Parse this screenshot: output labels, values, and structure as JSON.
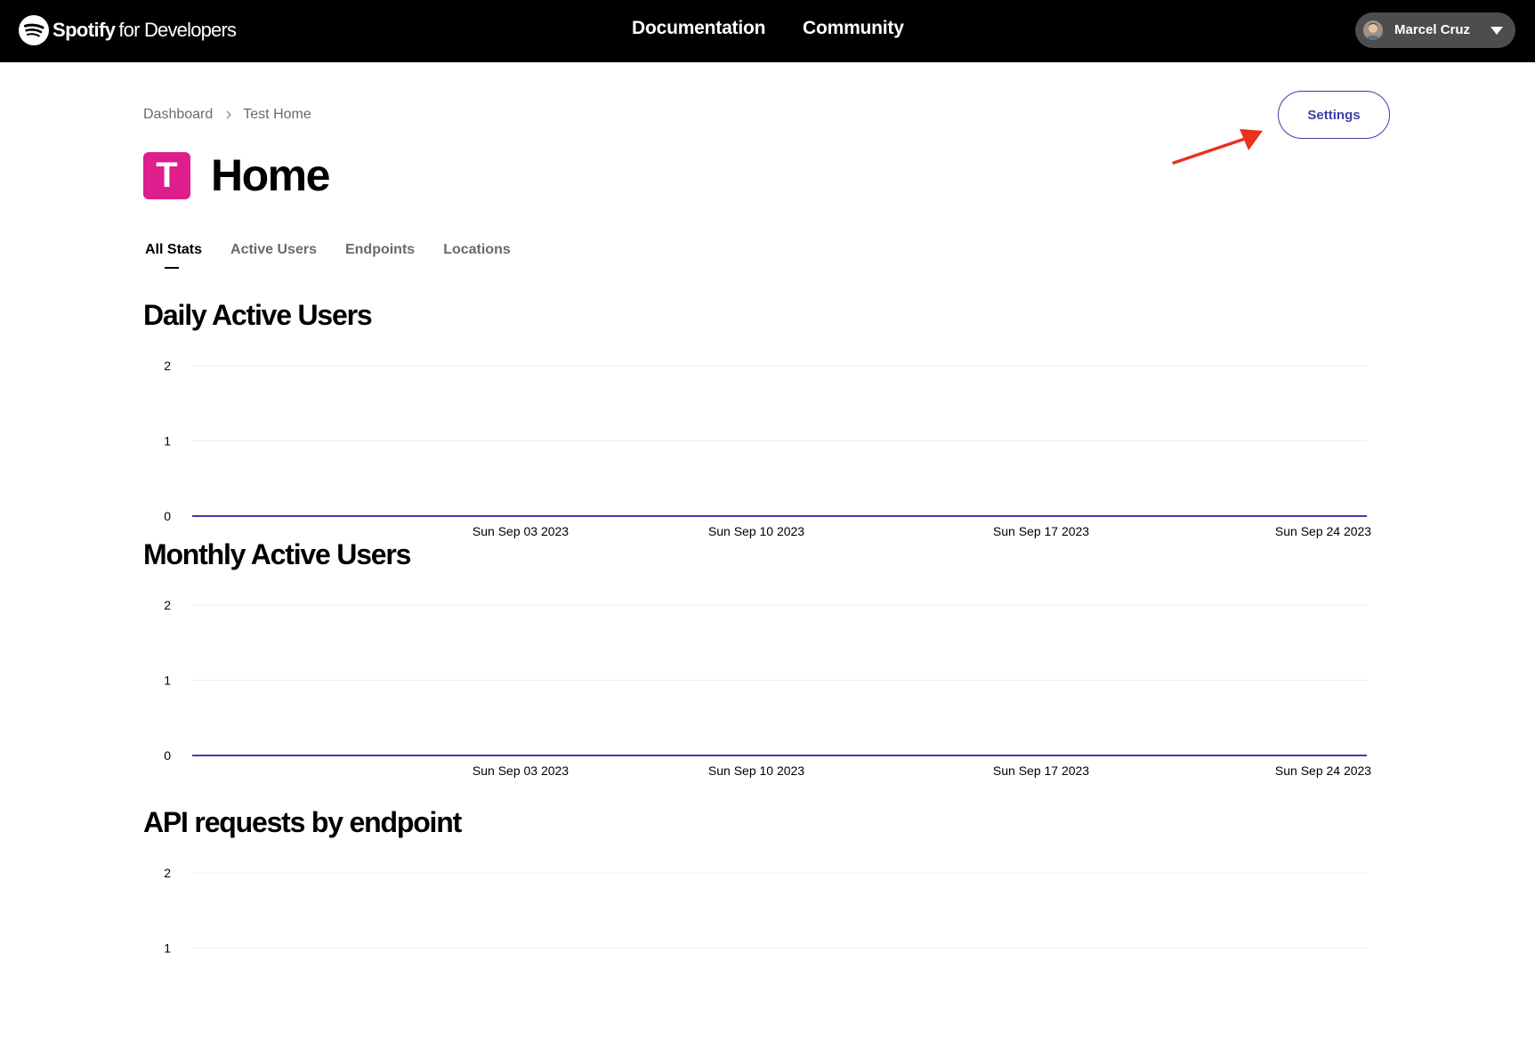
{
  "topbar": {
    "brand": "Spotify",
    "brand_sub": "for Developers",
    "nav": {
      "documentation": "Documentation",
      "community": "Community"
    },
    "user_name": "Marcel Cruz"
  },
  "breadcrumb": {
    "root": "Dashboard",
    "current": "Test Home"
  },
  "settings_label": "Settings",
  "app": {
    "icon_letter": "T",
    "title": "Home",
    "icon_color": "#dd1e8c"
  },
  "tabs": [
    {
      "label": "All Stats",
      "active": true
    },
    {
      "label": "Active Users",
      "active": false
    },
    {
      "label": "Endpoints",
      "active": false
    },
    {
      "label": "Locations",
      "active": false
    }
  ],
  "sections": {
    "daily": "Daily Active Users",
    "monthly": "Monthly Active Users",
    "api": "API requests by endpoint"
  },
  "colors": {
    "accent": "#3d3ea8",
    "line": "#3d3ea8",
    "annotation": "#e8321e"
  },
  "chart_data": [
    {
      "type": "line",
      "title": "Daily Active Users",
      "y_ticks": [
        0,
        1,
        2
      ],
      "ylim": [
        0,
        2
      ],
      "x_ticks": [
        "Sun Sep 03 2023",
        "Sun Sep 10 2023",
        "Sun Sep 17 2023",
        "Sun Sep 24 2023"
      ],
      "series": [
        {
          "values": [
            0,
            0
          ]
        }
      ],
      "grid": true
    },
    {
      "type": "line",
      "title": "Monthly Active Users",
      "y_ticks": [
        0,
        1,
        2
      ],
      "ylim": [
        0,
        2
      ],
      "x_ticks": [
        "Sun Sep 03 2023",
        "Sun Sep 10 2023",
        "Sun Sep 17 2023",
        "Sun Sep 24 2023"
      ],
      "series": [
        {
          "values": [
            0,
            0
          ]
        }
      ],
      "grid": true
    },
    {
      "type": "bar",
      "title": "API requests by endpoint",
      "y_ticks": [
        1,
        2
      ],
      "ylim": [
        0,
        2
      ],
      "grid": true
    }
  ]
}
